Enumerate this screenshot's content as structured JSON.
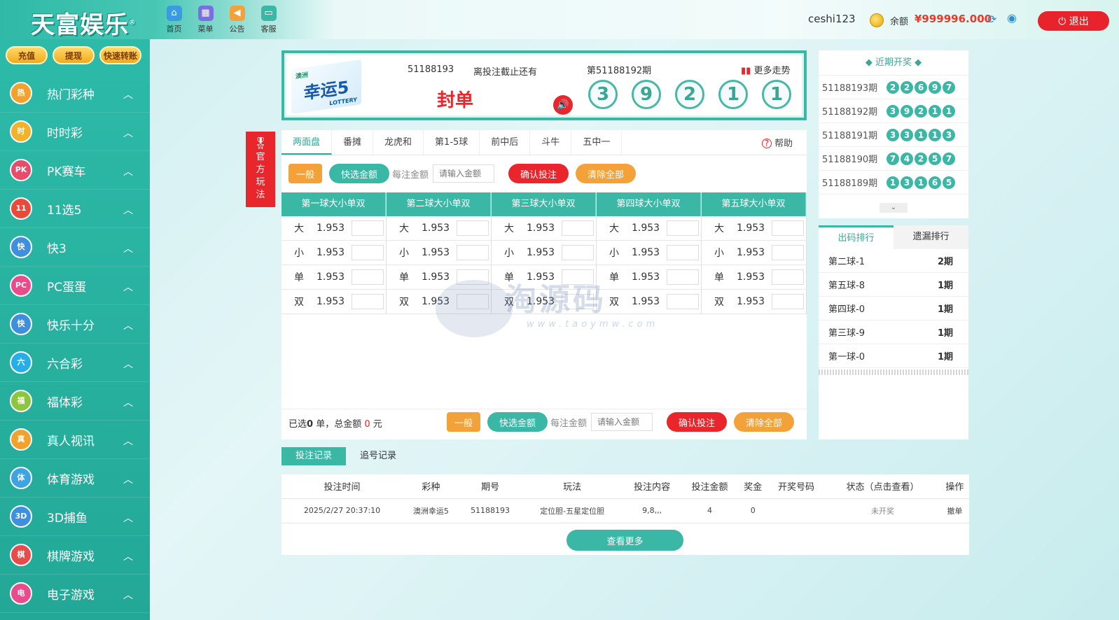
{
  "brand": {
    "logo": "天富娱乐",
    "reg": "®"
  },
  "topnav": [
    {
      "label": "首页",
      "icon": "home-icon"
    },
    {
      "label": "菜单",
      "icon": "grid-icon"
    },
    {
      "label": "公告",
      "icon": "speaker-icon"
    },
    {
      "label": "客服",
      "icon": "chat-icon"
    }
  ],
  "user": {
    "name": "ceshi123",
    "balance_label": "余额",
    "balance": "¥999996.000",
    "logout": "退出"
  },
  "sidebar": {
    "buttons": [
      "充值",
      "提现",
      "快速转账"
    ],
    "items": [
      {
        "label": "热门彩种",
        "icon": "热",
        "color": "#f2a22c"
      },
      {
        "label": "时时彩",
        "icon": "时",
        "color": "#f2b32c"
      },
      {
        "label": "PK赛车",
        "icon": "PK",
        "color": "#e94b6b"
      },
      {
        "label": "11选5",
        "icon": "11",
        "color": "#ea4a3a"
      },
      {
        "label": "快3",
        "icon": "快",
        "color": "#3e8fe0"
      },
      {
        "label": "PC蛋蛋",
        "icon": "PC",
        "color": "#e94b8b"
      },
      {
        "label": "快乐十分",
        "icon": "快",
        "color": "#3e8fe0"
      },
      {
        "label": "六合彩",
        "icon": "六",
        "color": "#27aee8"
      },
      {
        "label": "福体彩",
        "icon": "福",
        "color": "#8cc63e"
      },
      {
        "label": "真人视讯",
        "icon": "真",
        "color": "#f2a22c"
      },
      {
        "label": "体育游戏",
        "icon": "体",
        "color": "#3ea3e0"
      },
      {
        "label": "3D捕鱼",
        "icon": "3D",
        "color": "#3e8fe0"
      },
      {
        "label": "棋牌游戏",
        "icon": "棋",
        "color": "#e94b4b"
      },
      {
        "label": "电子游戏",
        "icon": "电",
        "color": "#e94b8b"
      }
    ]
  },
  "official": {
    "text": "官方玩法"
  },
  "lottery": {
    "logo_top": "澳洲",
    "logo_main": "幸运5",
    "logo_sub": "LOTTERY",
    "issue": "51188193",
    "countdown_label": "离投注截止还有",
    "status": "封单",
    "next_issue": "第51188192期",
    "more_trend": "更多走势",
    "balls": [
      "3",
      "9",
      "2",
      "1",
      "1"
    ]
  },
  "tabs": {
    "items": [
      "两面盘",
      "番摊",
      "龙虎和",
      "第1-5球",
      "前中后",
      "斗牛",
      "五中一"
    ],
    "active": 0,
    "help": "帮助"
  },
  "controls": {
    "general": "一般",
    "quick": "快选金额",
    "per_bet": "每注金额",
    "placeholder": "请输入金额",
    "confirm": "确认投注",
    "clear": "清除全部"
  },
  "grid": {
    "columns": [
      {
        "title": "第一球大小单双",
        "rows": [
          {
            "k": "大",
            "v": "1.953"
          },
          {
            "k": "小",
            "v": "1.953"
          },
          {
            "k": "单",
            "v": "1.953"
          },
          {
            "k": "双",
            "v": "1.953"
          }
        ]
      },
      {
        "title": "第二球大小单双",
        "rows": [
          {
            "k": "大",
            "v": "1.953"
          },
          {
            "k": "小",
            "v": "1.953"
          },
          {
            "k": "单",
            "v": "1.953"
          },
          {
            "k": "双",
            "v": "1.953"
          }
        ]
      },
      {
        "title": "第三球大小单双",
        "rows": [
          {
            "k": "大",
            "v": "1.953"
          },
          {
            "k": "小",
            "v": "1.953"
          },
          {
            "k": "单",
            "v": "1.953"
          },
          {
            "k": "双",
            "v": "1.953"
          }
        ]
      },
      {
        "title": "第四球大小单双",
        "rows": [
          {
            "k": "大",
            "v": "1.953"
          },
          {
            "k": "小",
            "v": "1.953"
          },
          {
            "k": "单",
            "v": "1.953"
          },
          {
            "k": "双",
            "v": "1.953"
          }
        ]
      },
      {
        "title": "第五球大小单双",
        "rows": [
          {
            "k": "大",
            "v": "1.953"
          },
          {
            "k": "小",
            "v": "1.953"
          },
          {
            "k": "单",
            "v": "1.953"
          },
          {
            "k": "双",
            "v": "1.953"
          }
        ]
      }
    ]
  },
  "footer": {
    "selected_prefix": "已选",
    "selected_count": "0",
    "selected_mid": " 单，总金额 ",
    "total": "0",
    "unit": " 元"
  },
  "recent": {
    "title": "近期开奖",
    "rows": [
      {
        "period": "51188193期",
        "balls": [
          "2",
          "2",
          "6",
          "9",
          "7"
        ]
      },
      {
        "period": "51188192期",
        "balls": [
          "3",
          "9",
          "2",
          "1",
          "1"
        ]
      },
      {
        "period": "51188191期",
        "balls": [
          "3",
          "3",
          "1",
          "1",
          "3"
        ]
      },
      {
        "period": "51188190期",
        "balls": [
          "7",
          "4",
          "2",
          "5",
          "7"
        ]
      },
      {
        "period": "51188189期",
        "balls": [
          "1",
          "3",
          "1",
          "6",
          "5"
        ]
      }
    ]
  },
  "rank": {
    "tabs": [
      "出码排行",
      "遗漏排行"
    ],
    "rows": [
      {
        "name": "第二球-1",
        "val": "2期"
      },
      {
        "name": "第五球-8",
        "val": "1期"
      },
      {
        "name": "第四球-0",
        "val": "1期"
      },
      {
        "name": "第三球-9",
        "val": "1期"
      },
      {
        "name": "第一球-0",
        "val": "1期"
      }
    ]
  },
  "records": {
    "tabs": [
      "投注记录",
      "追号记录"
    ],
    "headers": [
      "投注时间",
      "彩种",
      "期号",
      "玩法",
      "投注内容",
      "投注金额",
      "奖金",
      "开奖号码",
      "状态（点击查看）",
      "操作"
    ],
    "rows": [
      [
        "2025/2/27 20:37:10",
        "澳洲幸运5",
        "51188193",
        "定位胆-五星定位胆",
        "9,8,,,",
        "4",
        "0",
        "",
        "未开奖",
        "撤单"
      ]
    ],
    "more": "查看更多"
  },
  "watermark": {
    "main": "淘源码",
    "url": "www.taoymw.com"
  }
}
